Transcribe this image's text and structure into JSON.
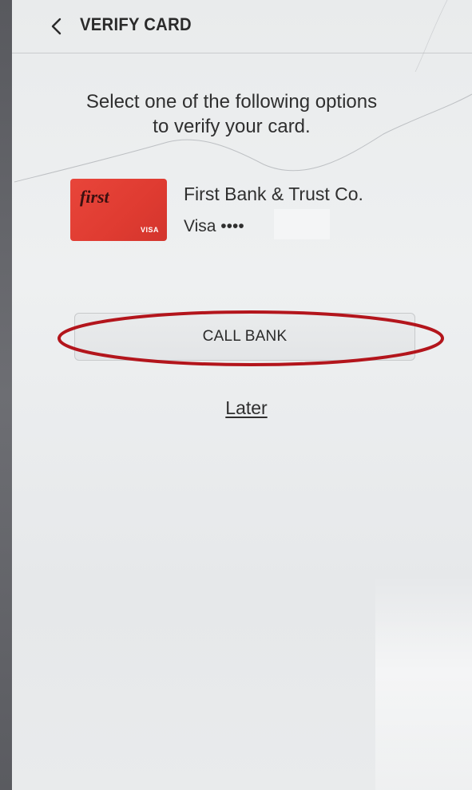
{
  "app_bar": {
    "title": "VERIFY CARD",
    "back_icon": "chevron-left-icon"
  },
  "instruction": {
    "line1": "Select one of the following options",
    "line2": "to verify your card."
  },
  "card": {
    "art_brand_text": "first",
    "art_network_text": "VISA",
    "bank_name": "First Bank & Trust Co.",
    "number_display": "Visa ••••"
  },
  "actions": {
    "call_bank_label": "CALL BANK",
    "later_label": "Later"
  },
  "colors": {
    "card_red": "#e0392f",
    "annotation_red": "#b3151c",
    "screen_bg": "#eceeef"
  }
}
